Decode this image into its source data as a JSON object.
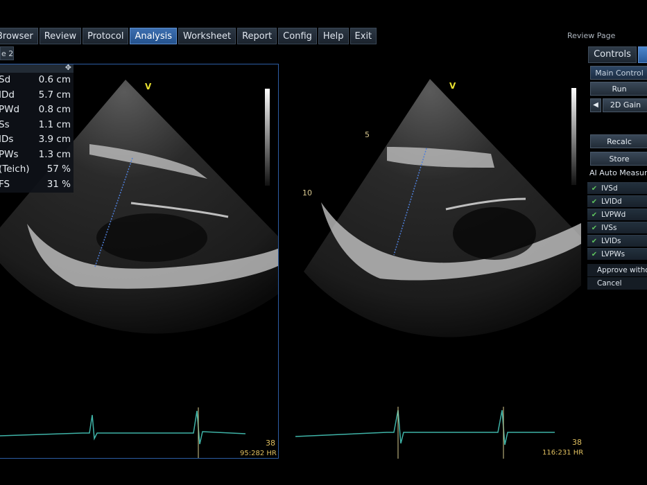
{
  "menu": {
    "items": [
      {
        "label": "Browser",
        "active": false
      },
      {
        "label": "Review",
        "active": false
      },
      {
        "label": "Protocol",
        "active": false
      },
      {
        "label": "Analysis",
        "active": true
      },
      {
        "label": "Worksheet",
        "active": false
      },
      {
        "label": "Report",
        "active": false
      },
      {
        "label": "Config",
        "active": false
      },
      {
        "label": "Help",
        "active": false
      },
      {
        "label": "Exit",
        "active": false
      }
    ],
    "review_page": "Review Page"
  },
  "sub_tab": "e 2",
  "measurements": [
    {
      "label": "Sd",
      "value": "0.6 cm"
    },
    {
      "label": "IDd",
      "value": "5.7 cm"
    },
    {
      "label": "PWd",
      "value": "0.8 cm"
    },
    {
      "label": "Ss",
      "value": "1.1 cm"
    },
    {
      "label": "IDs",
      "value": "3.9 cm"
    },
    {
      "label": "PWs",
      "value": "1.3 cm"
    },
    {
      "label": "(Teich)",
      "value": "57 %"
    },
    {
      "label": "FS",
      "value": "31 %"
    }
  ],
  "left_image": {
    "v_marker": "V",
    "frame": "38",
    "hr": "95:282 HR"
  },
  "right_image": {
    "v_marker": "V",
    "depth_5": "5",
    "depth_10": "10",
    "frame": "38",
    "hr": "116:231 HR"
  },
  "controls": {
    "tab_controls": "Controls",
    "main_controls": "Main Control",
    "run": "Run",
    "gain_arrow": "◀",
    "gain": "2D Gain",
    "recalc": "Recalc",
    "store": "Store",
    "ai_title": "AI Auto Measure",
    "checks": [
      "IVSd",
      "LVIDd",
      "LVPWd",
      "IVSs",
      "LVIDs",
      "LVPWs"
    ],
    "approve": "Approve witho",
    "cancel": "Cancel"
  },
  "colors": {
    "active_tab": "#2f62a3",
    "check_green": "#5ec35e",
    "ecg_trace": "#3fb4a8",
    "caliper_dots": "#4f7fd8"
  }
}
